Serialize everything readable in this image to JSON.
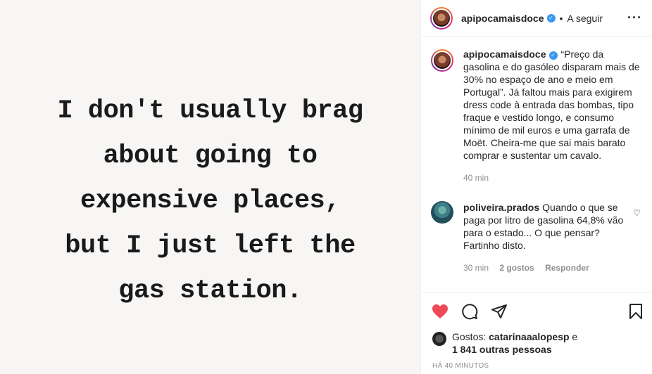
{
  "image": {
    "quote_lines": [
      "I don't usually brag",
      "about going to",
      "expensive places,",
      "but I just left the",
      "gas station."
    ]
  },
  "header": {
    "username": "apipocamaisdoce",
    "separator": "•",
    "follow_label": "A seguir",
    "more_glyph": "···"
  },
  "caption": {
    "username": "apipocamaisdoce",
    "text": "“Preço da gasolina e do gasóleo disparam mais de 30% no espaço de ano e meio em Portugal”. Já faltou mais para exigirem dress code à entrada das bombas, tipo fraque e vestido longo, e consumo mínimo de mil euros e uma garrafa de Moët. Cheira-me que sai mais barato comprar e sustentar um cavalo.",
    "time": "40 min"
  },
  "comment": {
    "username": "poliveira.prados",
    "text": "Quando o que se paga por litro de gasolina 64,8% vão para o estado... O que pensar? Fartinho disto.",
    "time": "30 min",
    "likes": "2 gostos",
    "reply_label": "Responder"
  },
  "likes": {
    "prefix": "Gostos:",
    "user": "catarinaaalopesp",
    "connector": "e",
    "others": "1 841 outras pessoas"
  },
  "timestamp": "HÁ 40 MINUTOS",
  "colors": {
    "like_red": "#ed4956",
    "verified_blue": "#3897f0",
    "muted": "#8e8e8e"
  }
}
